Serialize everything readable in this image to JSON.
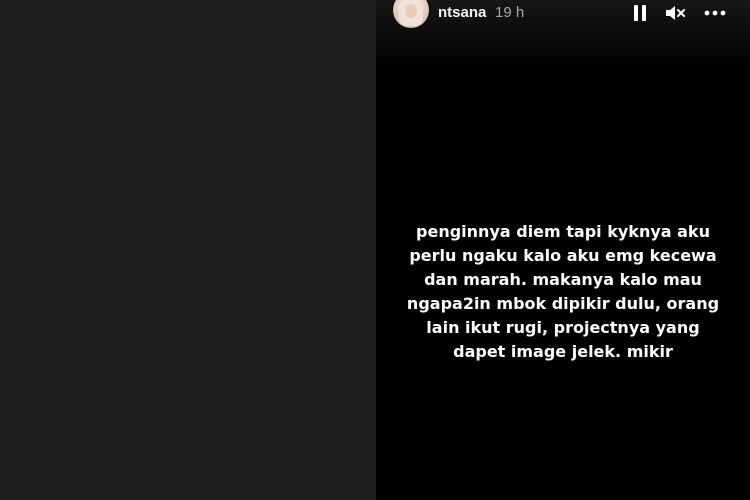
{
  "story": {
    "username": "ntsana",
    "timestamp": "19 h",
    "text": "penginnya diem tapi kyknya aku\nperlu ngaku kalo aku emg kecewa\ndan marah. makanya kalo mau\nngapa2in mbok dipikir dulu, orang\nlain ikut rugi, projectnya yang\ndapet image jelek. mikir"
  },
  "controls": {
    "pause_icon": "pause-icon",
    "mute_icon": "speaker-muted-icon",
    "more_icon": "more-horizontal-icon"
  },
  "colors": {
    "left_background": "#1e1e1e",
    "story_background": "#000000",
    "text": "#ffffff",
    "timestamp": "#a8a8a8"
  }
}
